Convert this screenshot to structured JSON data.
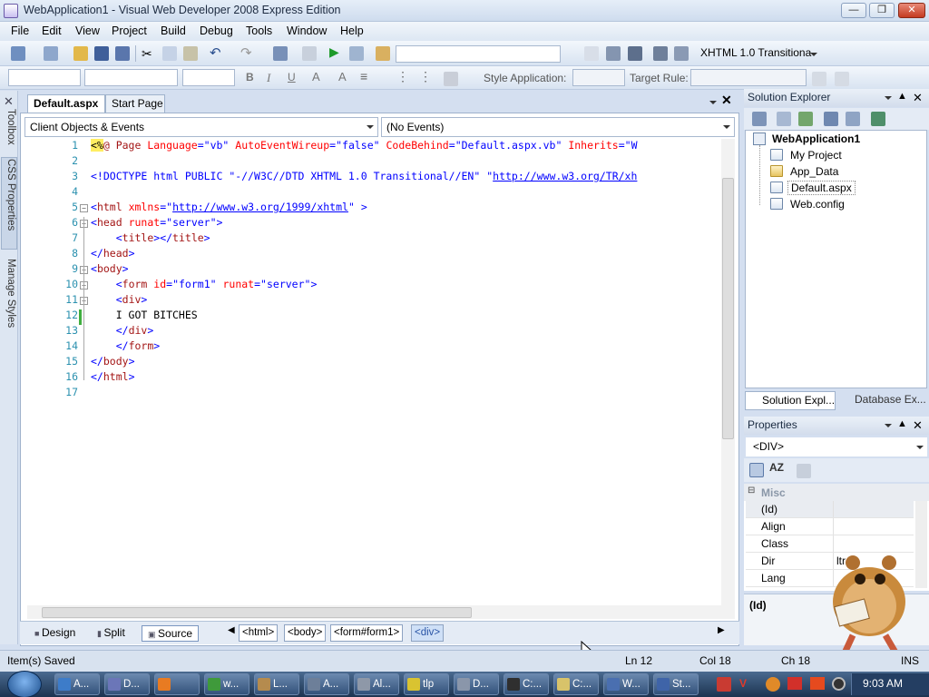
{
  "window": {
    "title": "WebApplication1 - Visual Web Developer 2008 Express Edition"
  },
  "menu": [
    "File",
    "Edit",
    "View",
    "Project",
    "Build",
    "Debug",
    "Tools",
    "Window",
    "Help"
  ],
  "toolbar": {
    "doctype": "XHTML 1.0 Transitiona",
    "style_application_label": "Style Application:",
    "target_rule_label": "Target Rule:"
  },
  "left_tabs": [
    "Toolbox",
    "CSS Properties",
    "Manage Styles"
  ],
  "doc_tabs": [
    {
      "label": "Default.aspx",
      "active": true
    },
    {
      "label": "Start Page",
      "active": false
    }
  ],
  "editor": {
    "object_dropdown": "Client Objects & Events",
    "event_dropdown": "(No Events)",
    "line_numbers": [
      "1",
      "2",
      "3",
      "4",
      "5",
      "6",
      "7",
      "8",
      "9",
      "10",
      "11",
      "12",
      "13",
      "14",
      "15",
      "16",
      "17"
    ],
    "code": [
      [
        "<%",
        "@ Page ",
        "Language",
        "=",
        "\"vb\"",
        " ",
        "AutoEventWireup",
        "=",
        "\"false\"",
        " ",
        "CodeBehind",
        "=",
        "\"Default.aspx.vb\"",
        " ",
        "Inherits",
        "=",
        "\"W"
      ],
      [],
      [
        "<!DOCTYPE html PUBLIC ",
        "\"-//W3C//DTD XHTML 1.0 Transitional//EN\"",
        " ",
        "\"",
        "http://www.w3.org/TR/xh"
      ],
      [],
      [
        "<",
        "html",
        " ",
        "xmlns",
        "=",
        "\"",
        "http://www.w3.org/1999/xhtml",
        "\"",
        " >"
      ],
      [
        "<",
        "head",
        " ",
        "runat",
        "=",
        "\"server\"",
        ">"
      ],
      [
        "    ",
        "<",
        "title",
        "></",
        "title",
        ">"
      ],
      [
        "</",
        "head",
        ">"
      ],
      [
        "<",
        "body",
        ">"
      ],
      [
        "    ",
        "<",
        "form",
        " ",
        "id",
        "=",
        "\"form1\"",
        " ",
        "runat",
        "=",
        "\"server\"",
        ">"
      ],
      [
        "    ",
        "<",
        "div",
        ">"
      ],
      [
        "    I GOT BITCHES"
      ],
      [
        "    ",
        "</",
        "div",
        ">"
      ],
      [
        "    ",
        "</",
        "form",
        ">"
      ],
      [
        "</",
        "body",
        ">"
      ],
      [
        "</",
        "html",
        ">"
      ],
      []
    ]
  },
  "views": {
    "design": "Design",
    "split": "Split",
    "source": "Source"
  },
  "breadcrumbs": [
    "<html>",
    "<body>",
    "<form#form1>",
    "<div>"
  ],
  "solution_explorer": {
    "title": "Solution Explorer",
    "project": "WebApplication1",
    "items": [
      "My Project",
      "App_Data",
      "Default.aspx",
      "Web.config"
    ],
    "tabs": [
      "Solution Expl...",
      "Database Ex..."
    ]
  },
  "properties": {
    "title": "Properties",
    "object": "<DIV>",
    "category": "Misc",
    "rows": [
      {
        "name": "(Id)",
        "value": ""
      },
      {
        "name": "Align",
        "value": ""
      },
      {
        "name": "Class",
        "value": ""
      },
      {
        "name": "Dir",
        "value": "ltr"
      },
      {
        "name": "Lang",
        "value": ""
      }
    ],
    "description_title": "(Id)"
  },
  "status": {
    "message": "Item(s) Saved",
    "line": "Ln 12",
    "col": "Col 18",
    "ch": "Ch 18",
    "mode": "INS"
  },
  "taskbar": {
    "tasks": [
      "A...",
      "D...",
      "",
      "w...",
      "L...",
      "A...",
      "Al...",
      "tlp",
      "D...",
      "C:...",
      "C:...",
      "W...",
      "St..."
    ],
    "clock": "9:03 AM"
  }
}
